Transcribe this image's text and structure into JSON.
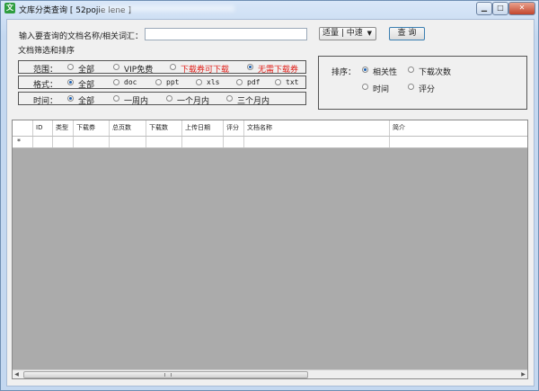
{
  "window": {
    "title": "文库分类查询 [ 52pojie lene ]",
    "app_icon_char": "文",
    "buttons": {
      "minimize": "▁",
      "maximize": "□",
      "close": "✕"
    }
  },
  "search": {
    "label": "输入要查询的文档名称/相关词汇：",
    "value": "",
    "combo_value": "适量 | 中速",
    "combo_arrow": "▼",
    "button_label": "查 询"
  },
  "filter": {
    "group_title": "文档筛选和排序",
    "scope": {
      "label": "范围：",
      "options": [
        {
          "label": "全部",
          "selected": false,
          "color": "#222222"
        },
        {
          "label": "VIP免费",
          "selected": false,
          "color": "#222222"
        },
        {
          "label": "下载券可下载",
          "selected": false,
          "color": "#e0201a"
        },
        {
          "label": "无需下载券",
          "selected": true,
          "color": "#e0201a"
        }
      ]
    },
    "format": {
      "label": "格式：",
      "options": [
        {
          "label": "全部",
          "selected": true
        },
        {
          "label": "doc",
          "selected": false
        },
        {
          "label": "ppt",
          "selected": false
        },
        {
          "label": "xls",
          "selected": false
        },
        {
          "label": "pdf",
          "selected": false
        },
        {
          "label": "txt",
          "selected": false
        }
      ]
    },
    "time": {
      "label": "时间：",
      "options": [
        {
          "label": "全部",
          "selected": true
        },
        {
          "label": "一周内",
          "selected": false
        },
        {
          "label": "一个月内",
          "selected": false
        },
        {
          "label": "三个月内",
          "selected": false
        }
      ]
    }
  },
  "sort": {
    "label": "排序：",
    "options": [
      {
        "label": "相关性",
        "selected": true
      },
      {
        "label": "下载次数",
        "selected": false
      },
      {
        "label": "时间",
        "selected": false
      },
      {
        "label": "评分",
        "selected": false
      }
    ]
  },
  "table": {
    "columns": [
      "ID",
      "类型",
      "下载券",
      "总页数",
      "下载数",
      "上传日期",
      "评分",
      "文档名称",
      "简介"
    ],
    "new_row_marker": "*",
    "scroll_left": "◀",
    "scroll_right": "▶"
  },
  "colors": {
    "accent": "#3c7fb1",
    "red_text": "#e0201a",
    "grid_bg": "#ababab"
  }
}
